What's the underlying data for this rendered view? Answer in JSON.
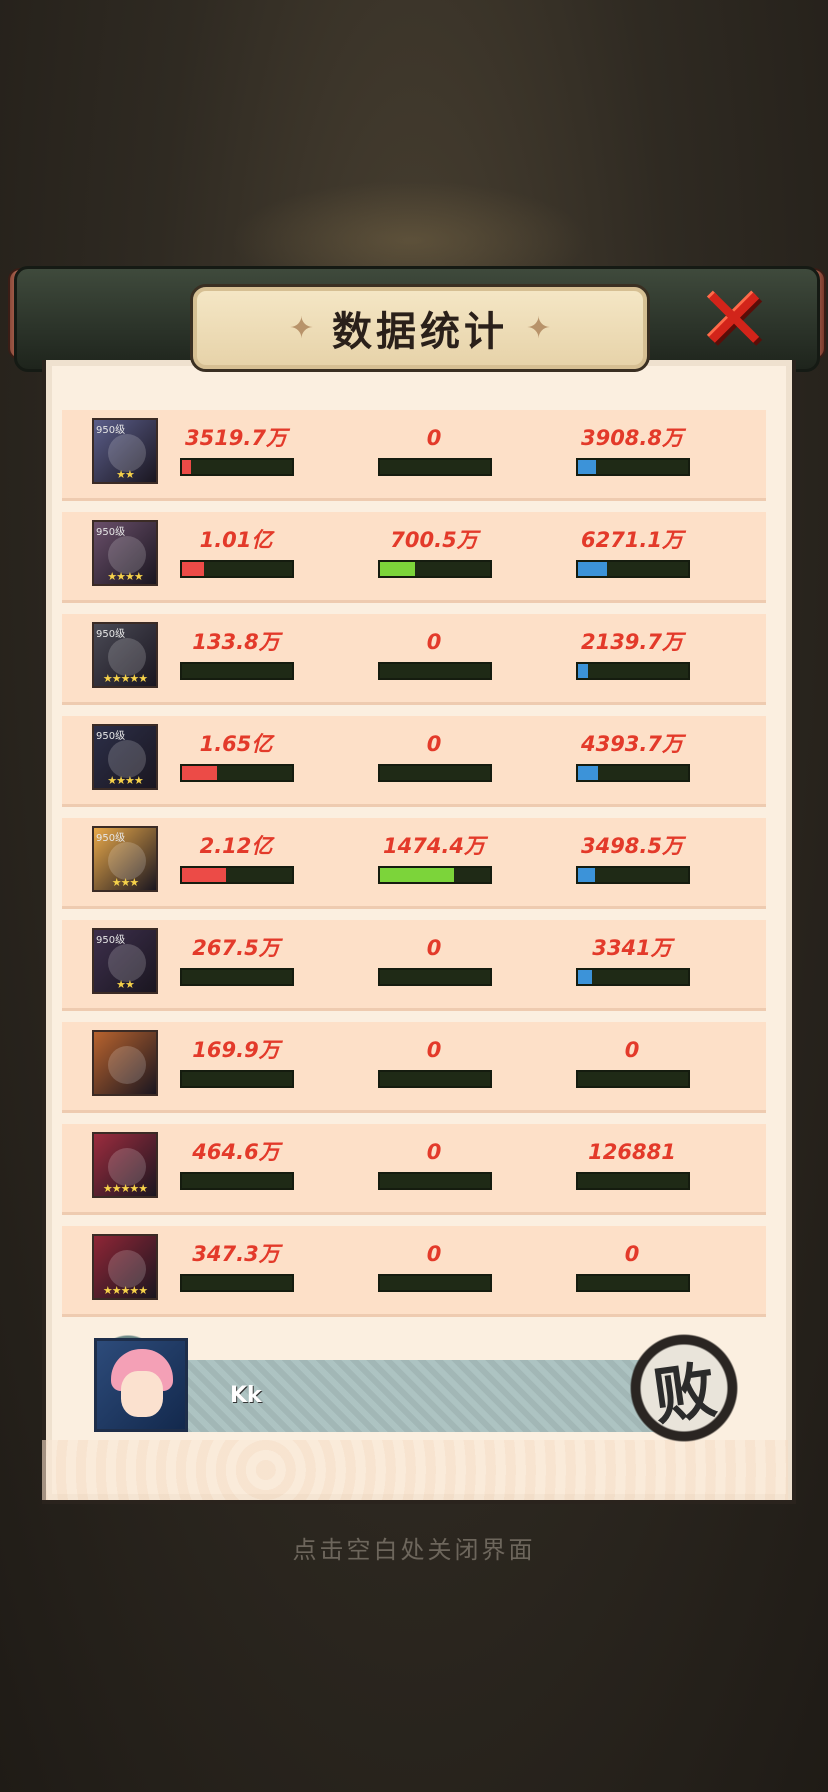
{
  "title": "数据统计",
  "close_icon": "close-x-icon",
  "colors": {
    "damage": "#ec4b47",
    "heal": "#7cd43a",
    "taken": "#3c93d9",
    "value_text": "#e33a2a"
  },
  "rows": [
    {
      "level": "950级",
      "stars": 2,
      "portrait_color": "#5b5e8a",
      "damage": "3519.7万",
      "damage_ratio": 0.08,
      "heal": "0",
      "heal_ratio": 0,
      "taken": "3908.8万",
      "taken_ratio": 0.16
    },
    {
      "level": "950级",
      "stars": 4,
      "portrait_color": "#6a4f6a",
      "damage": "1.01亿",
      "damage_ratio": 0.2,
      "heal": "700.5万",
      "heal_ratio": 0.32,
      "taken": "6271.1万",
      "taken_ratio": 0.26
    },
    {
      "level": "950级",
      "stars": 5,
      "portrait_color": "#4a4a55",
      "damage": "133.8万",
      "damage_ratio": 0,
      "heal": "0",
      "heal_ratio": 0,
      "taken": "2139.7万",
      "taken_ratio": 0.09
    },
    {
      "level": "950级",
      "stars": 4,
      "portrait_color": "#2c2f48",
      "damage": "1.65亿",
      "damage_ratio": 0.32,
      "heal": "0",
      "heal_ratio": 0,
      "taken": "4393.7万",
      "taken_ratio": 0.18
    },
    {
      "level": "950级",
      "stars": 3,
      "portrait_color": "#e9a94a",
      "damage": "2.12亿",
      "damage_ratio": 0.4,
      "heal": "1474.4万",
      "heal_ratio": 0.67,
      "taken": "3498.5万",
      "taken_ratio": 0.15
    },
    {
      "level": "950级",
      "stars": 2,
      "portrait_color": "#3d2f4c",
      "damage": "267.5万",
      "damage_ratio": 0,
      "heal": "0",
      "heal_ratio": 0,
      "taken": "3341万",
      "taken_ratio": 0.13
    },
    {
      "level": "",
      "stars": 0,
      "portrait_color": "#b8632e",
      "damage": "169.9万",
      "damage_ratio": 0,
      "heal": "0",
      "heal_ratio": 0,
      "taken": "0",
      "taken_ratio": 0
    },
    {
      "level": "",
      "stars": 5,
      "portrait_color": "#9c2c3e",
      "damage": "464.6万",
      "damage_ratio": 0,
      "heal": "0",
      "heal_ratio": 0,
      "taken": "126881",
      "taken_ratio": 0
    },
    {
      "level": "",
      "stars": 5,
      "portrait_color": "#8f2636",
      "damage": "347.3万",
      "damage_ratio": 0,
      "heal": "0",
      "heal_ratio": 0,
      "taken": "0",
      "taken_ratio": 0
    }
  ],
  "player": {
    "name": "Kk"
  },
  "result": {
    "label": "败"
  },
  "hint": "点击空白处关闭界面"
}
